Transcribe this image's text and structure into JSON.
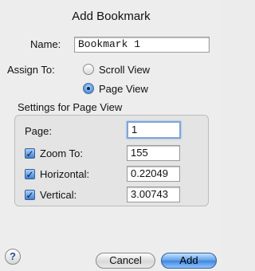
{
  "dialog": {
    "title": "Add Bookmark"
  },
  "name": {
    "label": "Name:",
    "value": "Bookmark 1"
  },
  "assign": {
    "label": "Assign To:",
    "options": [
      "Scroll View",
      "Page View"
    ],
    "selected": "Page View"
  },
  "settings": {
    "legend": "Settings for Page View",
    "page": {
      "label": "Page:",
      "value": "1"
    },
    "zoom": {
      "label": "Zoom To:",
      "value": "155",
      "checked": true
    },
    "horizontal": {
      "label": "Horizontal:",
      "value": "0.22049",
      "checked": true
    },
    "vertical": {
      "label": "Vertical:",
      "value": "3.00743",
      "checked": true
    }
  },
  "buttons": {
    "help": "?",
    "cancel": "Cancel",
    "add": "Add"
  },
  "colors": {
    "accent": "#3f86dd",
    "focus_ring": "#7ca6d8",
    "window_bg": "#ededed"
  }
}
